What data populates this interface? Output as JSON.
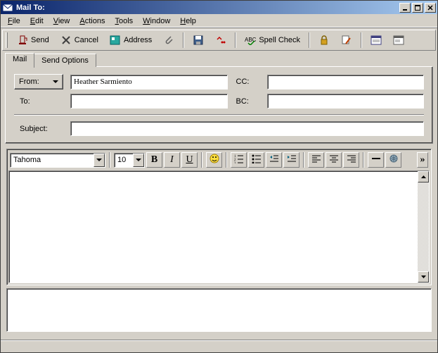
{
  "window": {
    "title": "Mail To:",
    "min": "_",
    "max": "❐",
    "close": "✕"
  },
  "menu": {
    "file": {
      "label": "File",
      "u": "F"
    },
    "edit": {
      "label": "Edit",
      "u": "E"
    },
    "view": {
      "label": "View",
      "u": "V"
    },
    "actions": {
      "label": "Actions",
      "u": "A"
    },
    "tools": {
      "label": "Tools",
      "u": "T"
    },
    "window": {
      "label": "Window",
      "u": "W"
    },
    "help": {
      "label": "Help",
      "u": "H"
    }
  },
  "toolbar": {
    "send": "Send",
    "cancel": "Cancel",
    "address": "Address",
    "spellcheck": "Spell Check"
  },
  "tabs": {
    "mail": "Mail",
    "sendoptions": "Send Options"
  },
  "header": {
    "from_label": "From:",
    "from_value": "Heather Sarmiento",
    "cc_label": "CC:",
    "cc_value": "",
    "to_label": "To:",
    "to_value": "",
    "bc_label": "BC:",
    "bc_value": "",
    "subject_label": "Subject:",
    "subject_value": ""
  },
  "format": {
    "font": "Tahoma",
    "size": "10"
  },
  "editor": {
    "content": ""
  },
  "colors": {
    "titlebar_start": "#0a246a",
    "titlebar_end": "#a6caf0",
    "face": "#d4d0c8"
  }
}
